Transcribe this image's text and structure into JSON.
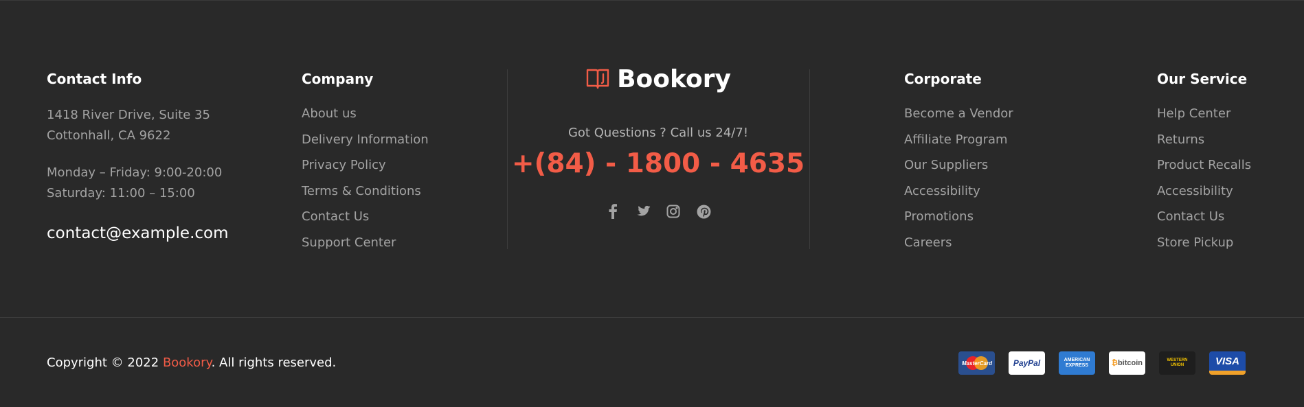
{
  "contact": {
    "heading": "Contact Info",
    "address_line1": "1418 River Drive, Suite 35",
    "address_line2": "Cottonhall, CA 9622",
    "hours_line1": "Monday – Friday: 9:00-20:00",
    "hours_line2": "Saturday: 11:00 – 15:00",
    "email": "contact@example.com"
  },
  "company": {
    "heading": "Company",
    "links": [
      "About us",
      "Delivery Information",
      "Privacy Policy",
      "Terms & Conditions",
      "Contact Us",
      "Support Center"
    ]
  },
  "center": {
    "logo_icon": "book-icon",
    "logo_text": "Bookory",
    "question": "Got Questions ? Call us 24/7!",
    "phone": "+(84) - 1800 - 4635",
    "socials": [
      "facebook-icon",
      "twitter-icon",
      "instagram-icon",
      "pinterest-icon"
    ]
  },
  "corporate": {
    "heading": "Corporate",
    "links": [
      "Become a Vendor",
      "Affiliate Program",
      "Our Suppliers",
      "Accessibility",
      "Promotions",
      "Careers"
    ]
  },
  "service": {
    "heading": "Our Service",
    "links": [
      "Help Center",
      "Returns",
      "Product Recalls",
      "Accessibility",
      "Contact Us",
      "Store Pickup"
    ]
  },
  "bottom": {
    "copyright_prefix": "Copyright © 2022 ",
    "brand": "Bookory",
    "copyright_suffix": ". All rights reserved.",
    "payments": [
      {
        "name": "mastercard",
        "label": "MasterCard"
      },
      {
        "name": "paypal",
        "label": "PayPal"
      },
      {
        "name": "american-express",
        "label": "AMERICAN EXPRESS"
      },
      {
        "name": "bitcoin",
        "label": "bitcoin"
      },
      {
        "name": "western-union",
        "label": "WESTERN UNION"
      },
      {
        "name": "visa",
        "label": "VISA"
      }
    ]
  },
  "colors": {
    "background": "#292929",
    "accent": "#f25c47",
    "heading": "#ffffff",
    "link": "#a3a3a3"
  }
}
